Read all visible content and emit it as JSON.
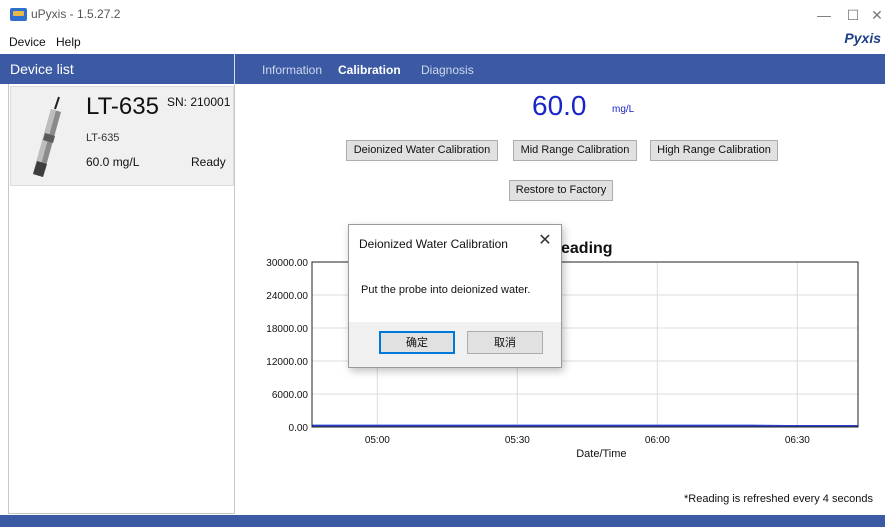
{
  "window": {
    "title": "uPyxis - 1.5.27.2",
    "brand": "Pyxis",
    "minimize_glyph": "—",
    "maximize_glyph": "☐",
    "close_glyph": "✕"
  },
  "menu": {
    "items": [
      "Device",
      "Help"
    ]
  },
  "sidebar": {
    "title": "Device list",
    "device": {
      "name": "LT-635",
      "serial": "SN: 210001",
      "model": "LT-635",
      "reading": "60.0  mg/L",
      "status": "Ready",
      "image_icon": "probe-icon"
    }
  },
  "tabs": [
    {
      "label": "Information",
      "active": false
    },
    {
      "label": "Calibration",
      "active": true
    },
    {
      "label": "Diagnosis",
      "active": false
    }
  ],
  "main": {
    "reading_value": "60.0",
    "reading_unit": "mg/L",
    "buttons": {
      "di_calibration": "Deionized Water Calibration",
      "mid_calibration": "Mid Range Calibration",
      "high_calibration": "High Range Calibration",
      "restore": "Restore to Factory"
    },
    "footnote": "*Reading is refreshed every 4 seconds"
  },
  "dialog": {
    "title": "Deionized Water Calibration",
    "close_glyph": "✕",
    "message": "Put the probe into deionized water.",
    "ok_label": "确定",
    "cancel_label": "取消"
  },
  "colors": {
    "header_blue": "#3b5aa3",
    "reading_blue": "#1a24c8",
    "series_blue": "#2a3ec8"
  },
  "chart_data": {
    "type": "line",
    "title_visible": "eading",
    "xlabel": "Date/Time",
    "ylabel": "",
    "y_ticks": [
      "30000.00",
      "24000.00",
      "18000.00",
      "12000.00",
      "6000.00",
      "0.00"
    ],
    "ylim": [
      0,
      30000
    ],
    "x_ticks": [
      "05:00",
      "05:30",
      "06:00",
      "06:30"
    ],
    "x_tick_minutes": [
      300,
      330,
      360,
      390
    ],
    "xlim_minutes": [
      286,
      403
    ],
    "grid": true,
    "series": [
      {
        "x_minutes": [
          286,
          298,
          310,
          322,
          334,
          346,
          358,
          370,
          380,
          388,
          396,
          403
        ],
        "values": [
          60,
          60,
          60,
          60,
          60,
          60,
          60,
          60,
          60,
          0,
          0,
          0
        ]
      }
    ]
  }
}
